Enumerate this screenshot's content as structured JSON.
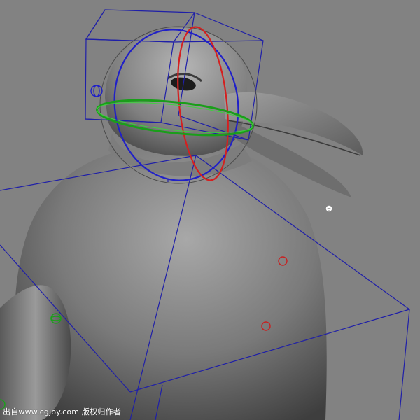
{
  "viewport": {
    "background": "#828282",
    "model": "penguin",
    "wireframe_color": "#1f1fa8",
    "rotate_x_color": "#d42020",
    "rotate_y_color": "#1a9e1a",
    "rotate_z_color": "#2020c8"
  },
  "watermark": {
    "text": "出自www.cgjoy.com 版权归作者"
  }
}
